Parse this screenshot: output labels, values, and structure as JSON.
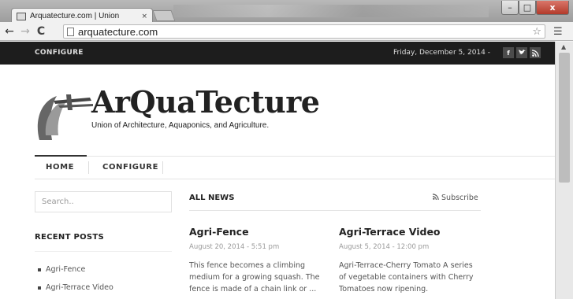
{
  "browser": {
    "tab_title": "Arquatecture.com | Union",
    "tab_close": "×",
    "url": "arquatecture.com",
    "window_controls": {
      "minimize": "–",
      "maximize": "□",
      "close": "x"
    },
    "icons": {
      "back": "back-arrow-icon",
      "forward": "forward-arrow-icon",
      "reload": "reload-icon",
      "bookmark": "star-icon",
      "menu": "hamburger-menu-icon"
    }
  },
  "topbar": {
    "configure": "CONFIGURE",
    "date": "Friday, December 5, 2014 -",
    "social": [
      "f",
      "t",
      "rss"
    ]
  },
  "logo": {
    "name": "ArQuaTecture",
    "tagline": "Union of Architecture, Aquaponics, and Agriculture."
  },
  "nav": {
    "items": [
      "HOME",
      "CONFIGURE"
    ]
  },
  "sidebar": {
    "search_placeholder": "Search..",
    "recent_heading": "RECENT POSTS",
    "recent_posts": [
      "Agri-Fence",
      "Agri-Terrace Video"
    ]
  },
  "news": {
    "heading": "ALL NEWS",
    "subscribe": "Subscribe",
    "posts": [
      {
        "title": "Agri-Fence",
        "date": "August 20, 2014 - 5:51 pm",
        "excerpt": "This fence becomes a climbing medium for a growing squash. The fence is made of a chain link or ..."
      },
      {
        "title": "Agri-Terrace Video",
        "date": "August 5, 2014 - 12:00 pm",
        "excerpt": "Agri-Terrace-Cherry Tomato A series of vegetable containers with Cherry Tomatoes now ripening."
      }
    ]
  },
  "colors": {
    "topbar_bg": "#1d1d1d",
    "page_bg": "#ffffff",
    "accent": "#333333"
  }
}
